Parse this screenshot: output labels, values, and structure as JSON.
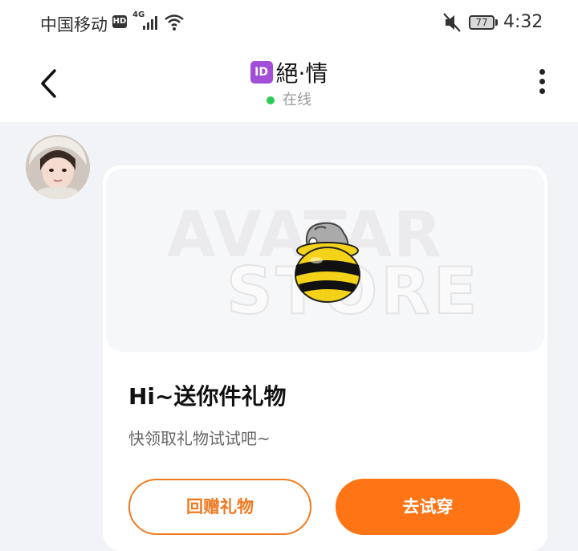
{
  "status_bar": {
    "carrier": "中国移动",
    "hd": "HD",
    "network": "4G",
    "battery": "77",
    "time": "4:32"
  },
  "header": {
    "id_badge": "ID",
    "title": "絕·情",
    "online": "在线"
  },
  "banner": {
    "watermark_line1": "AVATAR",
    "watermark_line2": "STORE"
  },
  "message": {
    "title": "Hi~送你件礼物",
    "subtitle": "快领取礼物试试吧~"
  },
  "buttons": {
    "return_gift": "回赠礼物",
    "try_on": "去试穿"
  },
  "colors": {
    "accent": "#ff7414",
    "online": "#2ecc55",
    "id_badge": "#a24fd8"
  }
}
